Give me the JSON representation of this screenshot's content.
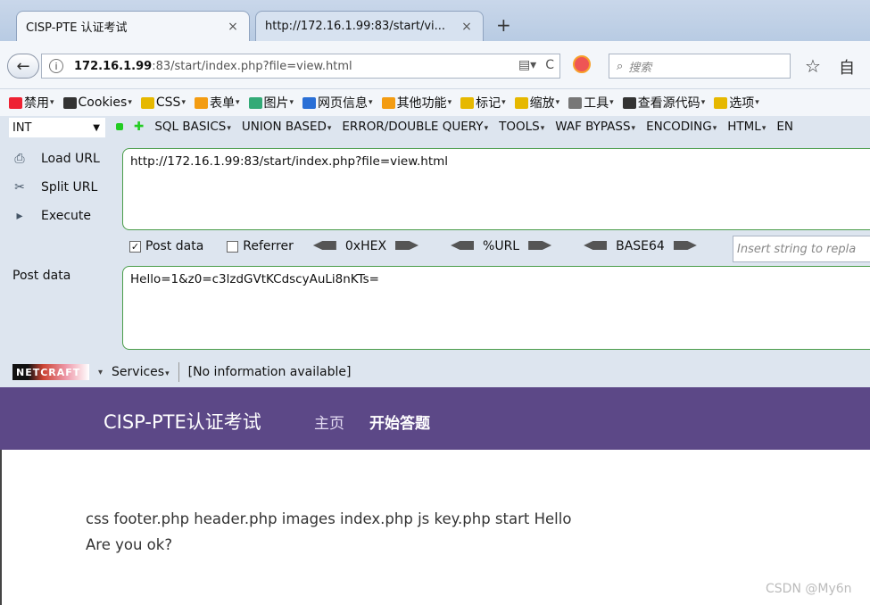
{
  "tabs": [
    {
      "title": "CISP-PTE 认证考试",
      "close": "×"
    },
    {
      "title": "http://172.16.1.99:83/start/vi...",
      "close": "×"
    }
  ],
  "new_tab": "+",
  "nav": {
    "back": "←",
    "info": "i",
    "url_host": "172.16.1.99",
    "url_rest": ":83/start/index.php?file=view.html",
    "reload": "C",
    "search_placeholder": "搜索",
    "search_icon": "search-icon",
    "star": "☆",
    "reading": "自"
  },
  "webdev": {
    "items": [
      {
        "label": "禁用",
        "color": "#e23"
      },
      {
        "label": "Cookies",
        "color": "#333"
      },
      {
        "label": "CSS",
        "color": "#e6b800"
      },
      {
        "label": "表单",
        "color": "#f39c12"
      },
      {
        "label": "图片",
        "color": "#3a7"
      },
      {
        "label": "网页信息",
        "color": "#2a6fd6"
      },
      {
        "label": "其他功能",
        "color": "#f39c12"
      },
      {
        "label": "标记",
        "color": "#e6b800"
      },
      {
        "label": "缩放",
        "color": "#e6b800"
      },
      {
        "label": "工具",
        "color": "#777"
      },
      {
        "label": "查看源代码",
        "color": "#333"
      },
      {
        "label": "选项",
        "color": "#e6b800"
      }
    ],
    "caret": "▾"
  },
  "hackbar": {
    "select_value": "INT",
    "menu": [
      "SQL BASICS",
      "UNION BASED",
      "ERROR/DOUBLE QUERY",
      "TOOLS",
      "WAF BYPASS",
      "ENCODING",
      "HTML",
      "EN"
    ],
    "load_url": "Load URL",
    "split_url": "Split URL",
    "execute": "Execute",
    "url_value": "http://172.16.1.99:83/start/index.php?file=view.html",
    "post_data_checkbox": "Post data",
    "post_data_checked": true,
    "referrer_checkbox": "Referrer",
    "hex": "0xHEX",
    "url_enc": "%URL",
    "base64": "BASE64",
    "replace_placeholder": "Insert string to repla",
    "post_label": "Post data",
    "post_value": "Hello=1&z0=c3lzdGVtKCdscyAuLi8nKTs="
  },
  "netcraft": {
    "logo": "NETCRAFT",
    "services": "Services",
    "info": "[No information available]"
  },
  "page": {
    "site_title": "CISP-PTE认证考试",
    "nav_home": "主页",
    "nav_start": "开始答题",
    "output_line1": "css footer.php header.php images index.php js key.php start Hello",
    "output_line2": "Are you ok?"
  },
  "watermark": "CSDN @My6n",
  "colors": {
    "header_purple": "#5c4887",
    "hackbar_bg": "#dde5ef",
    "textarea_border": "#4a9d4a"
  }
}
